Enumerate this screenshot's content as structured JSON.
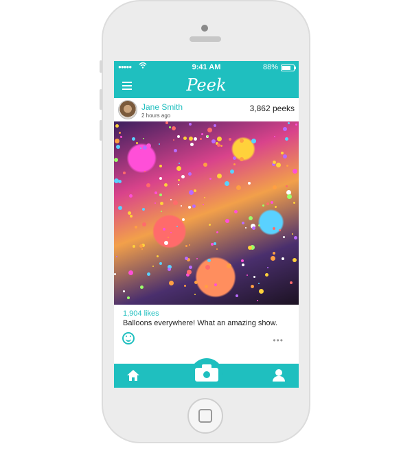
{
  "status_bar": {
    "signal": "●●●●●",
    "wifi_icon": "wifi-icon",
    "time": "9:41 AM",
    "battery_percent": "88%",
    "battery_level": 0.88
  },
  "nav": {
    "app_title": "Peek",
    "menu_icon": "hamburger-menu-icon"
  },
  "post": {
    "user_name": "Jane Smith",
    "time_ago": "2 hours ago",
    "peeks": "3,862 peeks",
    "likes": "1,904 likes",
    "caption": "Balloons everywhere! What an amazing show.",
    "more": "•••"
  },
  "tab_bar": {
    "items": [
      {
        "icon": "home-icon"
      },
      {
        "icon": "camera-icon"
      },
      {
        "icon": "profile-icon"
      }
    ]
  },
  "colors": {
    "accent": "#1fbfbf",
    "phone_body": "#ececec"
  }
}
